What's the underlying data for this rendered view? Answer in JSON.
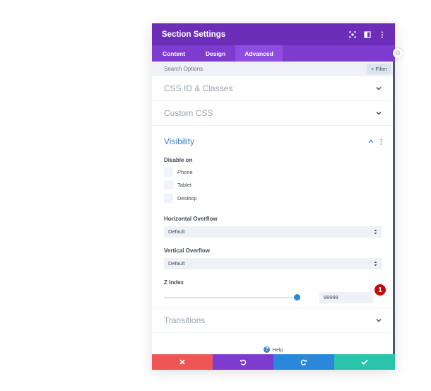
{
  "header": {
    "title": "Section Settings",
    "bg": "#6c2eb9"
  },
  "tabs": [
    {
      "label": "Content",
      "active": false
    },
    {
      "label": "Design",
      "active": false
    },
    {
      "label": "Advanced",
      "active": true
    }
  ],
  "search": {
    "placeholder": "Search Options",
    "filter_label": "+ Filter"
  },
  "sections": {
    "css_id": "CSS ID & Classes",
    "custom_css": "Custom CSS",
    "visibility": "Visibility",
    "transitions": "Transitions"
  },
  "visibility": {
    "disable_on_label": "Disable on",
    "devices": [
      "Phone",
      "Tablet",
      "Desktop"
    ],
    "horizontal_overflow": {
      "label": "Horizontal Overflow",
      "value": "Default"
    },
    "vertical_overflow": {
      "label": "Vertical Overflow",
      "value": "Default"
    },
    "z_index": {
      "label": "Z Index",
      "value": "99999"
    }
  },
  "badge": "1",
  "help_label": "Help",
  "footer": {
    "cancel_color": "#ef5555",
    "undo_color": "#7e3bd0",
    "redo_color": "#2b87da",
    "save_color": "#29c4a9"
  }
}
